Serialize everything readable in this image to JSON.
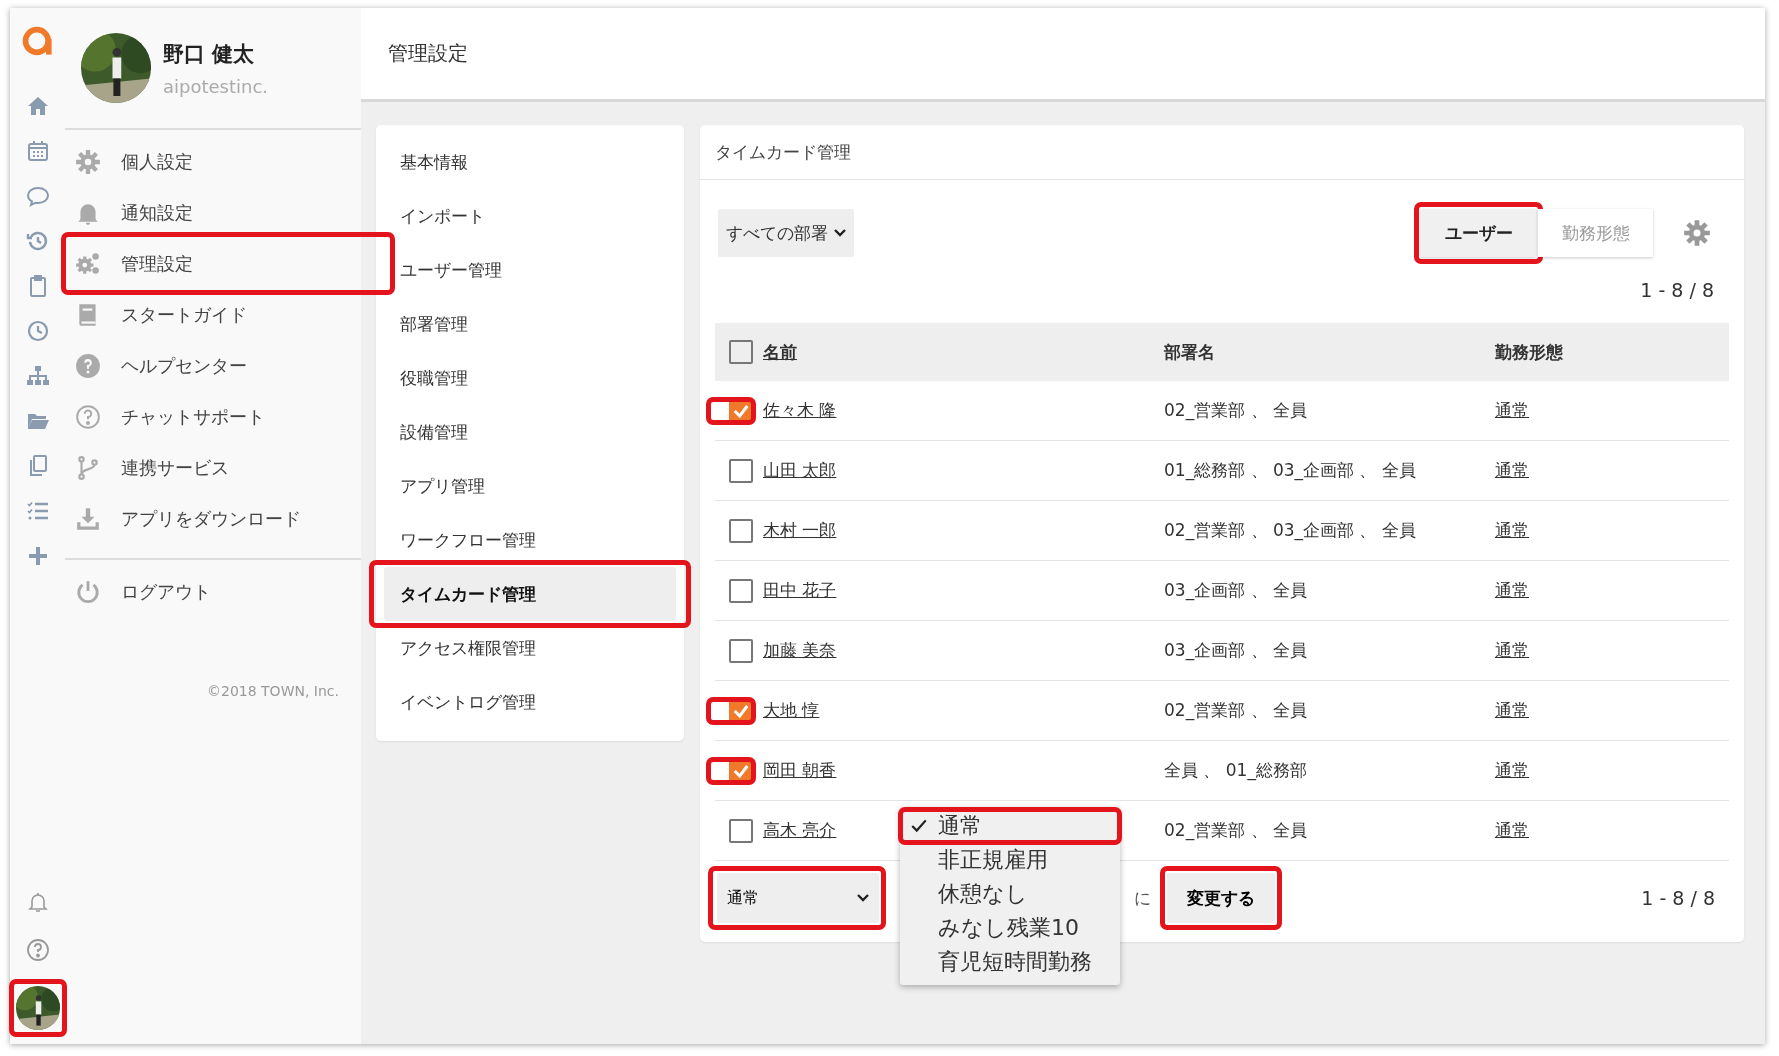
{
  "user": {
    "name": "野口 健太",
    "org": "aipotestinc.",
    "avatar_highlighted": true
  },
  "header": {
    "title": "管理設定"
  },
  "sidebar": {
    "items": [
      {
        "label": "個人設定",
        "selected": false,
        "highlighted": false
      },
      {
        "label": "通知設定",
        "selected": false,
        "highlighted": false
      },
      {
        "label": "管理設定",
        "selected": false,
        "highlighted": true
      },
      {
        "label": "スタートガイド",
        "selected": false,
        "highlighted": false
      },
      {
        "label": "ヘルプセンター",
        "selected": false,
        "highlighted": false
      },
      {
        "label": "チャットサポート",
        "selected": false,
        "highlighted": false
      },
      {
        "label": "連携サービス",
        "selected": false,
        "highlighted": false
      },
      {
        "label": "アプリをダウンロード",
        "selected": false,
        "highlighted": false
      }
    ],
    "logout": "ログアウト",
    "copyright": "©2018 TOWN, Inc."
  },
  "admin_menu": {
    "items": [
      {
        "label": "基本情報",
        "selected": false,
        "highlighted": false
      },
      {
        "label": "インポート",
        "selected": false,
        "highlighted": false
      },
      {
        "label": "ユーザー管理",
        "selected": false,
        "highlighted": false
      },
      {
        "label": "部署管理",
        "selected": false,
        "highlighted": false
      },
      {
        "label": "役職管理",
        "selected": false,
        "highlighted": false
      },
      {
        "label": "設備管理",
        "selected": false,
        "highlighted": false
      },
      {
        "label": "アプリ管理",
        "selected": false,
        "highlighted": false
      },
      {
        "label": "ワークフロー管理",
        "selected": false,
        "highlighted": false
      },
      {
        "label": "タイムカード管理",
        "selected": true,
        "highlighted": true
      },
      {
        "label": "アクセス権限管理",
        "selected": false,
        "highlighted": false
      },
      {
        "label": "イベントログ管理",
        "selected": false,
        "highlighted": false
      }
    ]
  },
  "panel": {
    "title": "タイムカード管理",
    "department_filter": "すべての部署",
    "view_toggle": [
      {
        "label": "ユーザー",
        "selected": true,
        "highlighted": true
      },
      {
        "label": "勤務形態",
        "selected": false,
        "highlighted": false
      }
    ],
    "count_top": "1 - 8 / 8",
    "header_checked": false,
    "columns": [
      {
        "label": "名前",
        "sortable": true
      },
      {
        "label": "部署名",
        "sortable": false
      },
      {
        "label": "勤務形態",
        "sortable": false
      }
    ],
    "rows": [
      {
        "name": "佐々木 隆",
        "department": "02_営業部 、 全員",
        "work_type": "通常",
        "checked": true,
        "highlighted": true
      },
      {
        "name": "山田 太郎",
        "department": "01_総務部 、 03_企画部 、 全員",
        "work_type": "通常",
        "checked": false,
        "highlighted": false
      },
      {
        "name": "木村 一郎",
        "department": "02_営業部 、 03_企画部 、 全員",
        "work_type": "通常",
        "checked": false,
        "highlighted": false
      },
      {
        "name": "田中 花子",
        "department": "03_企画部 、 全員",
        "work_type": "通常",
        "checked": false,
        "highlighted": false
      },
      {
        "name": "加藤 美奈",
        "department": "03_企画部 、 全員",
        "work_type": "通常",
        "checked": false,
        "highlighted": false
      },
      {
        "name": "大地 惇",
        "department": "02_営業部 、 全員",
        "work_type": "通常",
        "checked": true,
        "highlighted": true
      },
      {
        "name": "岡田 朝香",
        "department": "全員 、 01_総務部",
        "work_type": "通常",
        "checked": true,
        "highlighted": true
      },
      {
        "name": "高木 亮介",
        "department": "02_営業部 、 全員",
        "work_type": "通常",
        "checked": false,
        "highlighted": false
      }
    ],
    "work_type_select": {
      "value": "通常",
      "highlighted": true
    },
    "to_label": "に",
    "apply_button": {
      "label": "変更する",
      "highlighted": true
    },
    "count_bottom": "1 - 8 / 8",
    "dropdown": {
      "options": [
        {
          "label": "通常",
          "selected": true,
          "highlighted": true
        },
        {
          "label": "非正規雇用",
          "selected": false,
          "highlighted": false
        },
        {
          "label": "休憩なし",
          "selected": false,
          "highlighted": false
        },
        {
          "label": "みなし残業10",
          "selected": false,
          "highlighted": false
        },
        {
          "label": "育児短時間勤務",
          "selected": false,
          "highlighted": false
        }
      ]
    }
  }
}
